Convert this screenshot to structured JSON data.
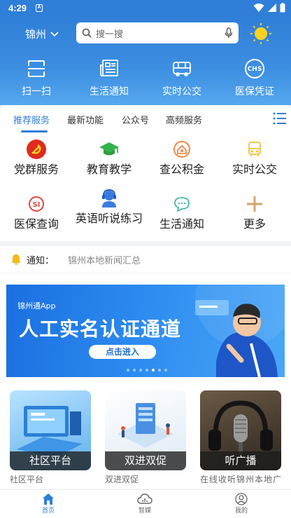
{
  "status_bar": {
    "time": "4:29",
    "notification_letter": "A"
  },
  "header": {
    "city": "锦州",
    "search_placeholder": "搜一搜",
    "quick_actions": [
      {
        "label": "扫一扫",
        "icon": "scan-icon"
      },
      {
        "label": "生活通知",
        "icon": "newspaper-icon"
      },
      {
        "label": "实时公交",
        "icon": "bus-icon"
      },
      {
        "label": "医保凭证",
        "icon": "chs-medical-insurance-icon"
      }
    ]
  },
  "tabs": {
    "items": [
      "推荐服务",
      "最新功能",
      "公众号",
      "高频服务"
    ],
    "active": "推荐服务"
  },
  "services": [
    {
      "label": "党群服务",
      "icon": "party-emblem-icon"
    },
    {
      "label": "教育教学",
      "icon": "graduation-cap-icon"
    },
    {
      "label": "查公积金",
      "icon": "housing-fund-icon"
    },
    {
      "label": "实时公交",
      "icon": "bus-outline-icon"
    },
    {
      "label": "医保查询",
      "icon": "si-insurance-icon"
    },
    {
      "label": "英语听说练习",
      "icon": "headset-person-icon"
    },
    {
      "label": "生活通知",
      "icon": "chat-bubble-icon"
    },
    {
      "label": "更多",
      "icon": "plus-icon"
    }
  ],
  "notice": {
    "label": "通知：",
    "content": "锦州本地新闻汇总"
  },
  "banner": {
    "app_name": "锦州通App",
    "title": "人工实名认证通道",
    "button": "点击进入",
    "dot_count": 7,
    "active_dot": 4
  },
  "cards": [
    {
      "caption": "社区平台",
      "subtitle": "社区平台"
    },
    {
      "caption": "双进双促",
      "subtitle": "双进双促"
    },
    {
      "caption": "听广播",
      "subtitle": "在线收听锦州本地广播"
    }
  ],
  "bottom_nav": [
    {
      "label": "首页",
      "icon": "home-icon",
      "active": true
    },
    {
      "label": "智媒",
      "icon": "cloud-chart-icon",
      "active": false
    },
    {
      "label": "我的",
      "icon": "person-icon",
      "active": false
    }
  ],
  "colors": {
    "primary": "#2f7fd8",
    "notice_bell": "#f6b81a"
  }
}
